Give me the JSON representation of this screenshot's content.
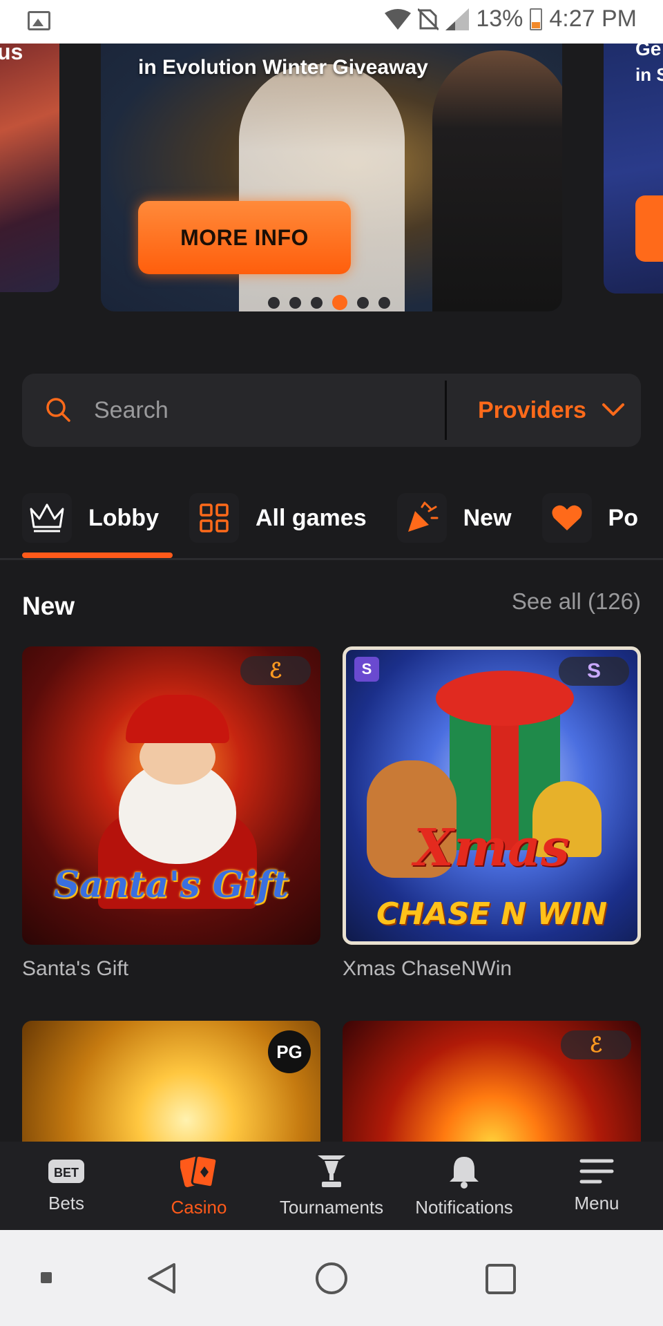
{
  "status_bar": {
    "battery": "13%",
    "time": "4:27 PM",
    "icons": [
      "image-icon",
      "wifi-icon",
      "no-sim-icon",
      "signal-icon",
      "battery-icon"
    ]
  },
  "carousel": {
    "slides": [
      {
        "partial_title": "us"
      },
      {
        "title": "in Evolution Winter Giveaway",
        "button": "MORE INFO"
      },
      {
        "partial_title_1": "Ge",
        "partial_title_2": "in S"
      }
    ],
    "page_count": 6,
    "active_page": 4
  },
  "search": {
    "placeholder": "Search",
    "providers_label": "Providers"
  },
  "tabs": [
    {
      "label": "Lobby",
      "icon": "crown-icon",
      "active": true
    },
    {
      "label": "All games",
      "icon": "grid-icon",
      "active": false
    },
    {
      "label": "New",
      "icon": "party-popper-icon",
      "active": false
    },
    {
      "label": "Po",
      "icon": "heart-icon",
      "active": false
    }
  ],
  "new_section": {
    "title": "New",
    "see_all": "See all (126)",
    "games": [
      {
        "name": "Santa's Gift",
        "logo_text": "Santa's Gift",
        "provider_badge": "evolution-logo"
      },
      {
        "name": "Xmas ChaseNWin",
        "logo_line_1": "Xmas",
        "logo_line_2": "CHASE N WIN",
        "provider_badge": "spinomenal-logo"
      },
      {
        "name": "",
        "provider_badge": "PG"
      },
      {
        "name": "",
        "provider_badge": "evolution-logo"
      }
    ]
  },
  "bottom_nav": [
    {
      "label": "Bets",
      "icon": "bet-ticket-icon",
      "active": false
    },
    {
      "label": "Casino",
      "icon": "cards-icon",
      "active": true
    },
    {
      "label": "Tournaments",
      "icon": "trophy-icon",
      "active": false
    },
    {
      "label": "Notifications",
      "icon": "bell-icon",
      "active": false
    },
    {
      "label": "Menu",
      "icon": "hamburger-icon",
      "active": false
    }
  ],
  "colors": {
    "accent": "#ff6a1a",
    "background": "#1b1b1d",
    "surface": "#27272a"
  }
}
